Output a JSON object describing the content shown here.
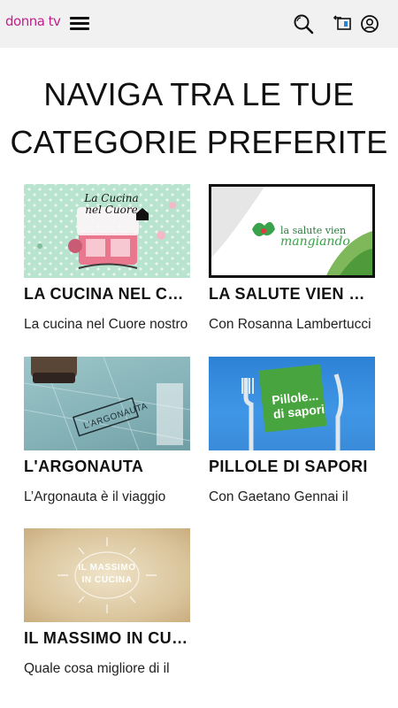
{
  "header": {
    "logo_text": "donna tv",
    "menu_icon": "hamburger-menu-icon",
    "search_icon": "search-icon",
    "cast_icon": "cast-icon",
    "account_icon": "user-account-icon",
    "brand_color": "#c0208f"
  },
  "page": {
    "headline_line1": "NAVIGA TRA LE TUE",
    "headline_line2": "CATEGORIE PREFERITE"
  },
  "categories": [
    {
      "title": "LA CUCINA NEL CUORE",
      "description": "La cucina nel Cuore nostro",
      "thumb_text_line1": "La Cucina",
      "thumb_text_line2": "nel Cuore"
    },
    {
      "title": "LA SALUTE VIEN MANGIANDO",
      "description": "Con Rosanna Lambertucci",
      "thumb_text_line1": "la salute vien",
      "thumb_text_line2": "mangiando"
    },
    {
      "title": "L'ARGONAUTA",
      "description": "L’Argonauta è il viaggio",
      "thumb_text_line1": "L'ARGONAUTA",
      "thumb_text_line2": ""
    },
    {
      "title": "PILLOLE DI SAPORI",
      "description": "Con Gaetano Gennai il",
      "thumb_text_line1": "Pillole...",
      "thumb_text_line2": "di sapori"
    },
    {
      "title": "IL MASSIMO IN CUCINA",
      "description": "Quale cosa migliore di il",
      "thumb_text_line1": "IL MASSIMO",
      "thumb_text_line2": "IN CUCINA"
    }
  ]
}
